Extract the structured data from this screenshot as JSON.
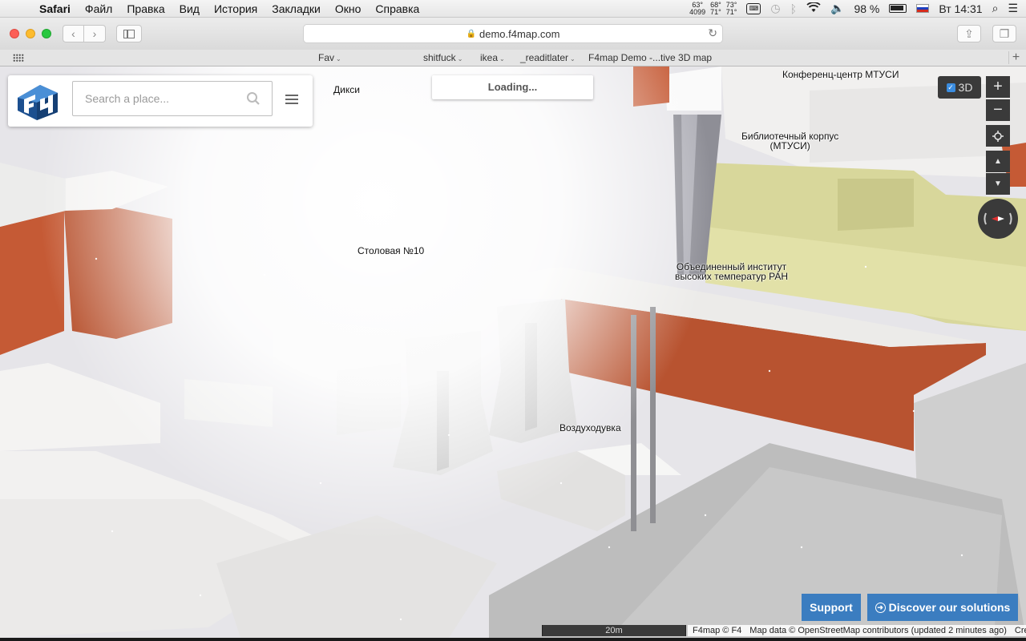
{
  "menubar": {
    "app": "Safari",
    "items": [
      "Файл",
      "Правка",
      "Вид",
      "История",
      "Закладки",
      "Окно",
      "Справка"
    ],
    "temps": [
      [
        "63°",
        "4099"
      ],
      [
        "68°",
        "71°"
      ],
      [
        "73°",
        "71°"
      ]
    ],
    "battery": "98 %",
    "clock": "Вт 14:31"
  },
  "browser": {
    "url": "demo.f4map.com",
    "bookmarks": {
      "fav": "Fav",
      "shitfuck": "shitfuck",
      "ikea": "ikea",
      "readitlater": "_readitlater",
      "tab": "F4map Demo -...tive 3D map"
    }
  },
  "map": {
    "labels": {
      "diksi": "Дикси",
      "conference": "Конференц-центр МТУСИ",
      "library_1": "Библиотечный корпус",
      "library_2": "(МТУСИ)",
      "canteen": "Столовая №10",
      "institute_1": "Объединенный институт",
      "institute_2": "высоких температур РАН",
      "blower": "Воздуходувка"
    },
    "colors": {
      "brick": "#c55a35",
      "sand": "#d9d89c",
      "ui_dark": "#3a3a3a",
      "accent_blue": "#3b7dc0"
    }
  },
  "search": {
    "placeholder": "Search a place..."
  },
  "loading": "Loading...",
  "controls": {
    "toggle3d": "3D",
    "zoom_in": "+",
    "zoom_out": "−",
    "tilt_up": "▲",
    "tilt_down": "▼"
  },
  "footer": {
    "support": "Support",
    "discover": "Discover our solutions",
    "scale": "20m",
    "attrib_f4": "F4map © F4",
    "attrib_osm": "Map data © OpenStreetMap contributors (updated 2 minutes ago)",
    "credits": "Credits"
  }
}
